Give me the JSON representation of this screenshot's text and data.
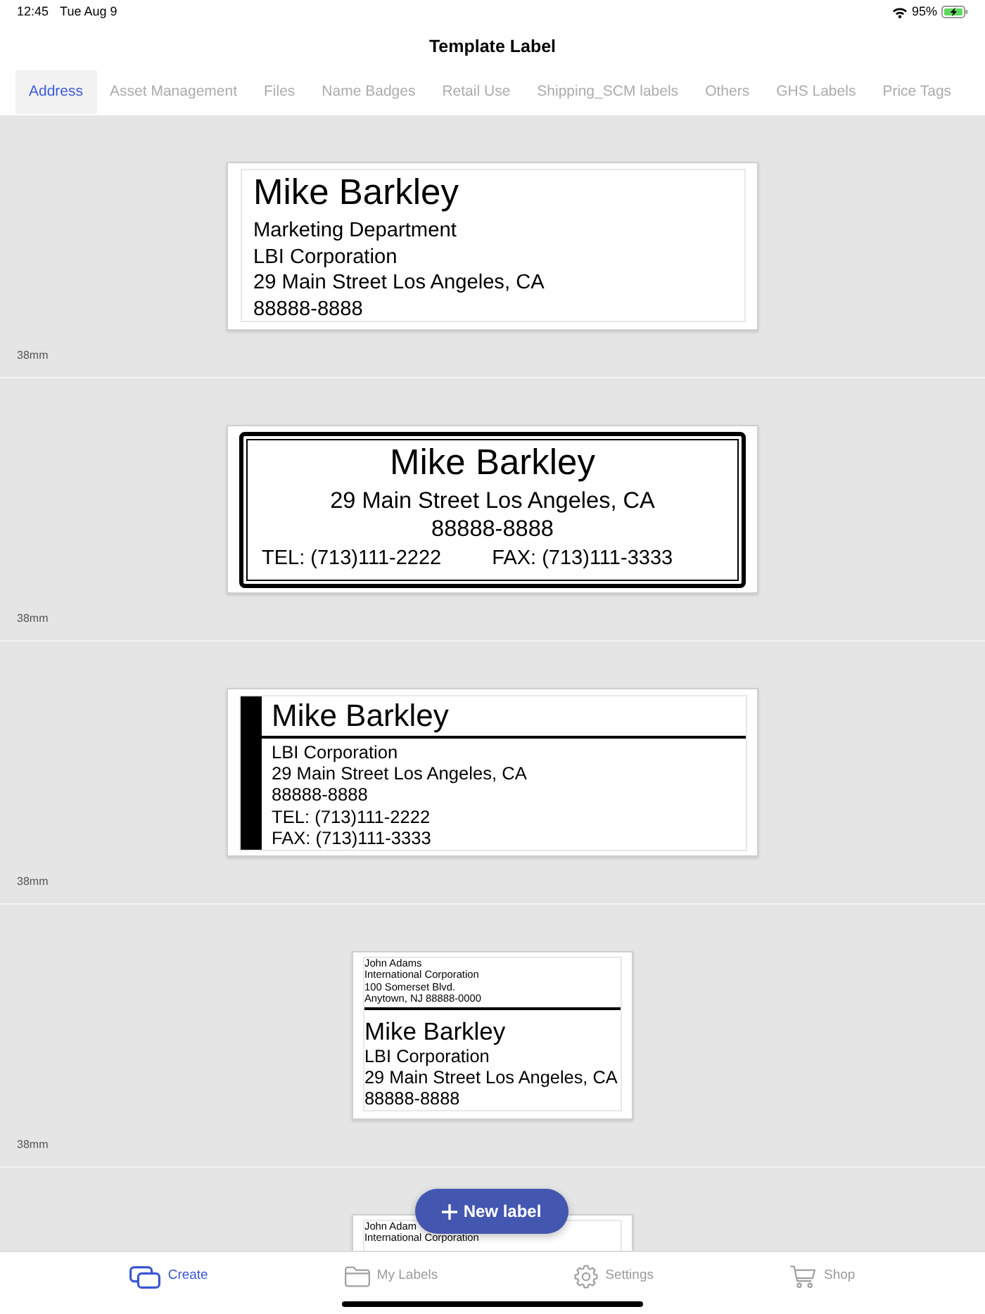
{
  "status_bar": {
    "time": "12:45",
    "date": "Tue Aug 9",
    "battery": "95%"
  },
  "header": {
    "title": "Template Label"
  },
  "tabs": [
    {
      "label": "Address",
      "selected": true
    },
    {
      "label": "Asset Management",
      "selected": false
    },
    {
      "label": "Files",
      "selected": false
    },
    {
      "label": "Name Badges",
      "selected": false
    },
    {
      "label": "Retail Use",
      "selected": false
    },
    {
      "label": "Shipping_SCM labels",
      "selected": false
    },
    {
      "label": "Others",
      "selected": false
    },
    {
      "label": "GHS Labels",
      "selected": false
    },
    {
      "label": "Price Tags",
      "selected": false
    }
  ],
  "templates": [
    {
      "kind": "plain",
      "name": "Mike Barkley",
      "lines": [
        "Marketing Department",
        "LBI Corporation",
        "29 Main Street Los Angeles, CA",
        "88888-8888"
      ],
      "size": "38mm"
    },
    {
      "kind": "double_border",
      "name": "Mike Barkley",
      "lines": [
        "29 Main Street Los Angeles, CA",
        "88888-8888"
      ],
      "contacts": [
        "TEL: (713)111-2222",
        "FAX: (713)111-3333"
      ],
      "size": "38mm"
    },
    {
      "kind": "side_bar",
      "name": "Mike Barkley",
      "lines": [
        "LBI Corporation",
        "29 Main Street Los Angeles, CA",
        "88888-8888",
        "TEL: (713)111-2222",
        "FAX: (713)111-3333"
      ],
      "size": "38mm"
    },
    {
      "kind": "return_address",
      "sender": [
        "John Adams",
        "International Corporation",
        "100 Somerset Blvd.",
        "Anytown, NJ 88888-0000"
      ],
      "name": "Mike Barkley",
      "lines": [
        "LBI Corporation",
        "29 Main Street Los Angeles, CA",
        "88888-8888"
      ],
      "size": "38mm"
    },
    {
      "kind": "return_address",
      "sender": [
        "John Adam",
        "International Corporation"
      ]
    }
  ],
  "new_label_button": {
    "label": "New label"
  },
  "bottom_tabs": [
    {
      "label": "Create",
      "selected": true
    },
    {
      "label": "My Labels",
      "selected": false
    },
    {
      "label": "Settings",
      "selected": false
    },
    {
      "label": "Shop",
      "selected": false
    }
  ]
}
